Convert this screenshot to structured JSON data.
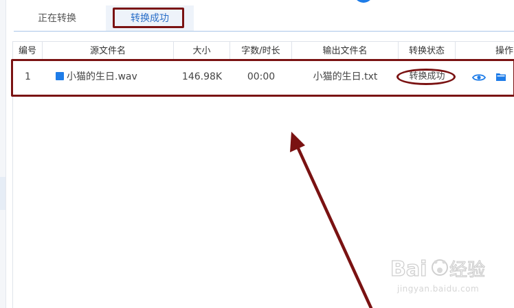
{
  "tabs": {
    "converting": "正在转换",
    "success": "转换成功"
  },
  "table": {
    "headers": {
      "index": "编号",
      "source_name": "源文件名",
      "size": "大小",
      "chars_duration": "字数/时长",
      "output_name": "输出文件名",
      "status": "转换状态",
      "actions": "操作"
    },
    "rows": [
      {
        "index": "1",
        "source_name": "小猫的生日.wav",
        "size": "146.98K",
        "chars_duration": "00:00",
        "output_name": "小猫的生日.txt",
        "status": "转换成功"
      }
    ]
  },
  "icons": {
    "file": "audio-file-icon",
    "view": "eye-icon",
    "folder": "folder-icon"
  },
  "colors": {
    "accent": "#1e7ce8",
    "annotation": "#7a1212"
  },
  "watermark": {
    "brand": "Bai du 经验",
    "url": "jingyan.baidu.com"
  }
}
